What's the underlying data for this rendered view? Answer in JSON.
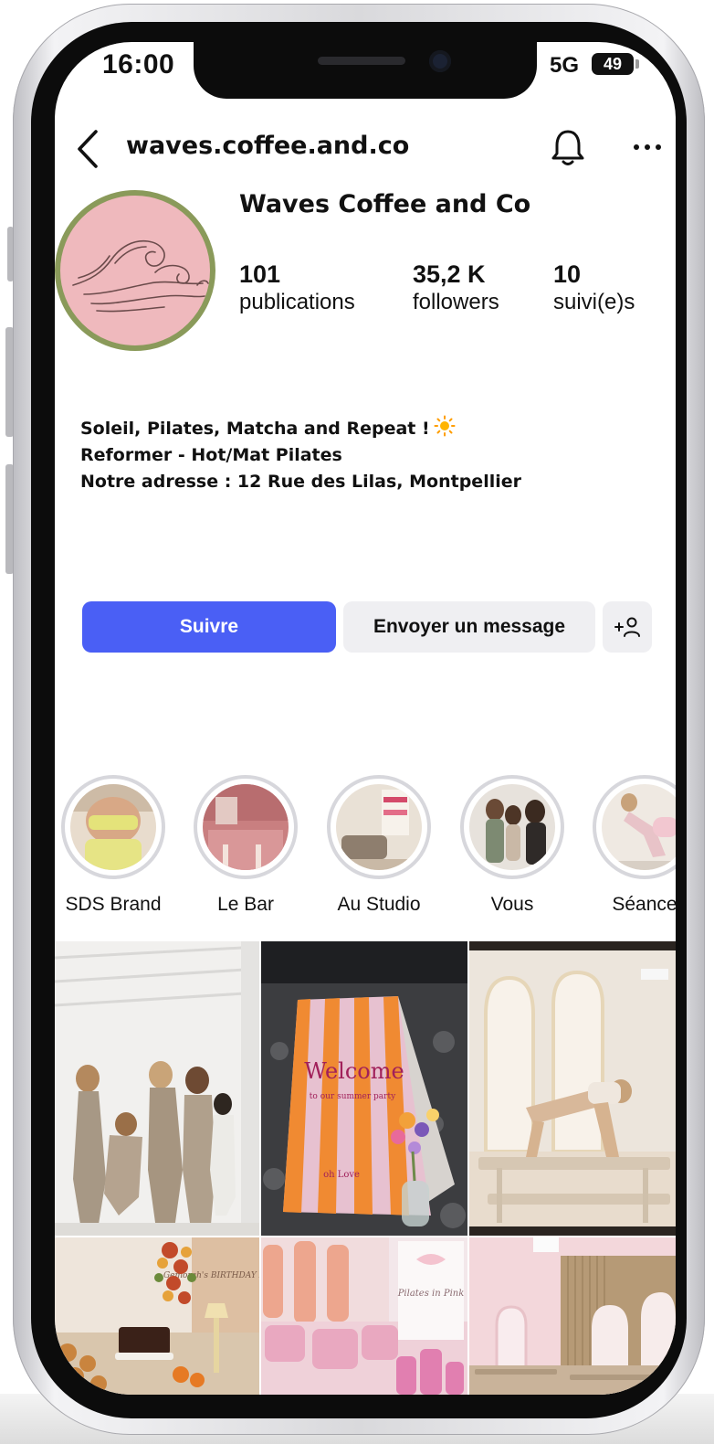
{
  "status_bar": {
    "time": "16:00",
    "network": "5G",
    "battery": "49"
  },
  "header": {
    "username": "waves.coffee.and.co"
  },
  "profile": {
    "display_name": "Waves Coffee and Co",
    "stats": [
      {
        "value": "101",
        "label": "publications"
      },
      {
        "value": "35,2 K",
        "label": "followers"
      },
      {
        "value": "10",
        "label": "suivi(e)s"
      }
    ],
    "bio": [
      "Soleil, Pilates, Matcha and Repeat !",
      "Reformer - Hot/Mat Pilates",
      "Notre adresse : 12 Rue des Lilas, Montpellier"
    ]
  },
  "actions": {
    "follow": "Suivre",
    "message": "Envoyer un message",
    "add_user_icon": "add-user-icon"
  },
  "highlights": [
    {
      "label": "SDS Brand"
    },
    {
      "label": "Le Bar"
    },
    {
      "label": "Au Studio"
    },
    {
      "label": "Vous"
    },
    {
      "label": "Séance"
    }
  ],
  "posts": [
    {
      "text": ""
    },
    {
      "text": "Welcome",
      "subtext": "to our summer party",
      "footer": "oh Love"
    },
    {
      "text": ""
    },
    {
      "text": "Gemorah's BIRTHDAY Brunch"
    },
    {
      "text": "Pilates in Pink"
    },
    {
      "text": ""
    }
  ],
  "colors": {
    "accent": "#4a5ff5",
    "avatar_bg": "#efb9bd",
    "avatar_ring": "#8a9a5a"
  }
}
